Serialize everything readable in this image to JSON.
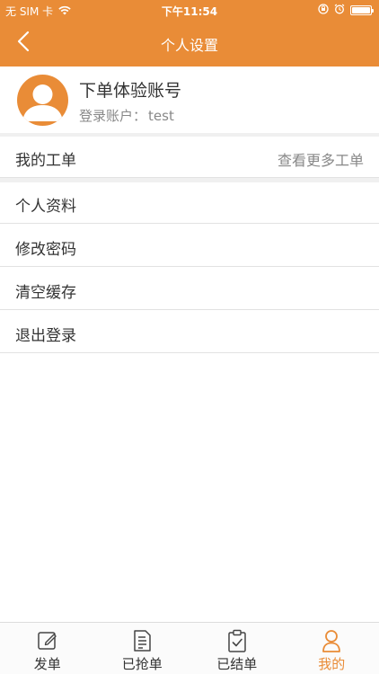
{
  "status_bar": {
    "carrier": "无 SIM 卡",
    "time": "下午11:54"
  },
  "nav": {
    "title": "个人设置",
    "back_icon": "chevron-left-icon"
  },
  "profile": {
    "name": "下单体验账号",
    "account_label": "登录账户：",
    "account_value": "test",
    "avatar_icon": "user-avatar-icon"
  },
  "orders_row": {
    "label": "我的工单",
    "more": "查看更多工单"
  },
  "menu": [
    {
      "label": "个人资料"
    },
    {
      "label": "修改密码"
    },
    {
      "label": "清空缓存"
    },
    {
      "label": "退出登录"
    }
  ],
  "tabs": [
    {
      "label": "发单",
      "icon": "edit-icon",
      "active": false
    },
    {
      "label": "已抢单",
      "icon": "document-icon",
      "active": false
    },
    {
      "label": "已结单",
      "icon": "clipboard-check-icon",
      "active": false
    },
    {
      "label": "我的",
      "icon": "user-icon",
      "active": true
    }
  ],
  "colors": {
    "accent": "#E98C37",
    "text": "#333333",
    "muted": "#888888",
    "divider": "#E2E2E2"
  }
}
